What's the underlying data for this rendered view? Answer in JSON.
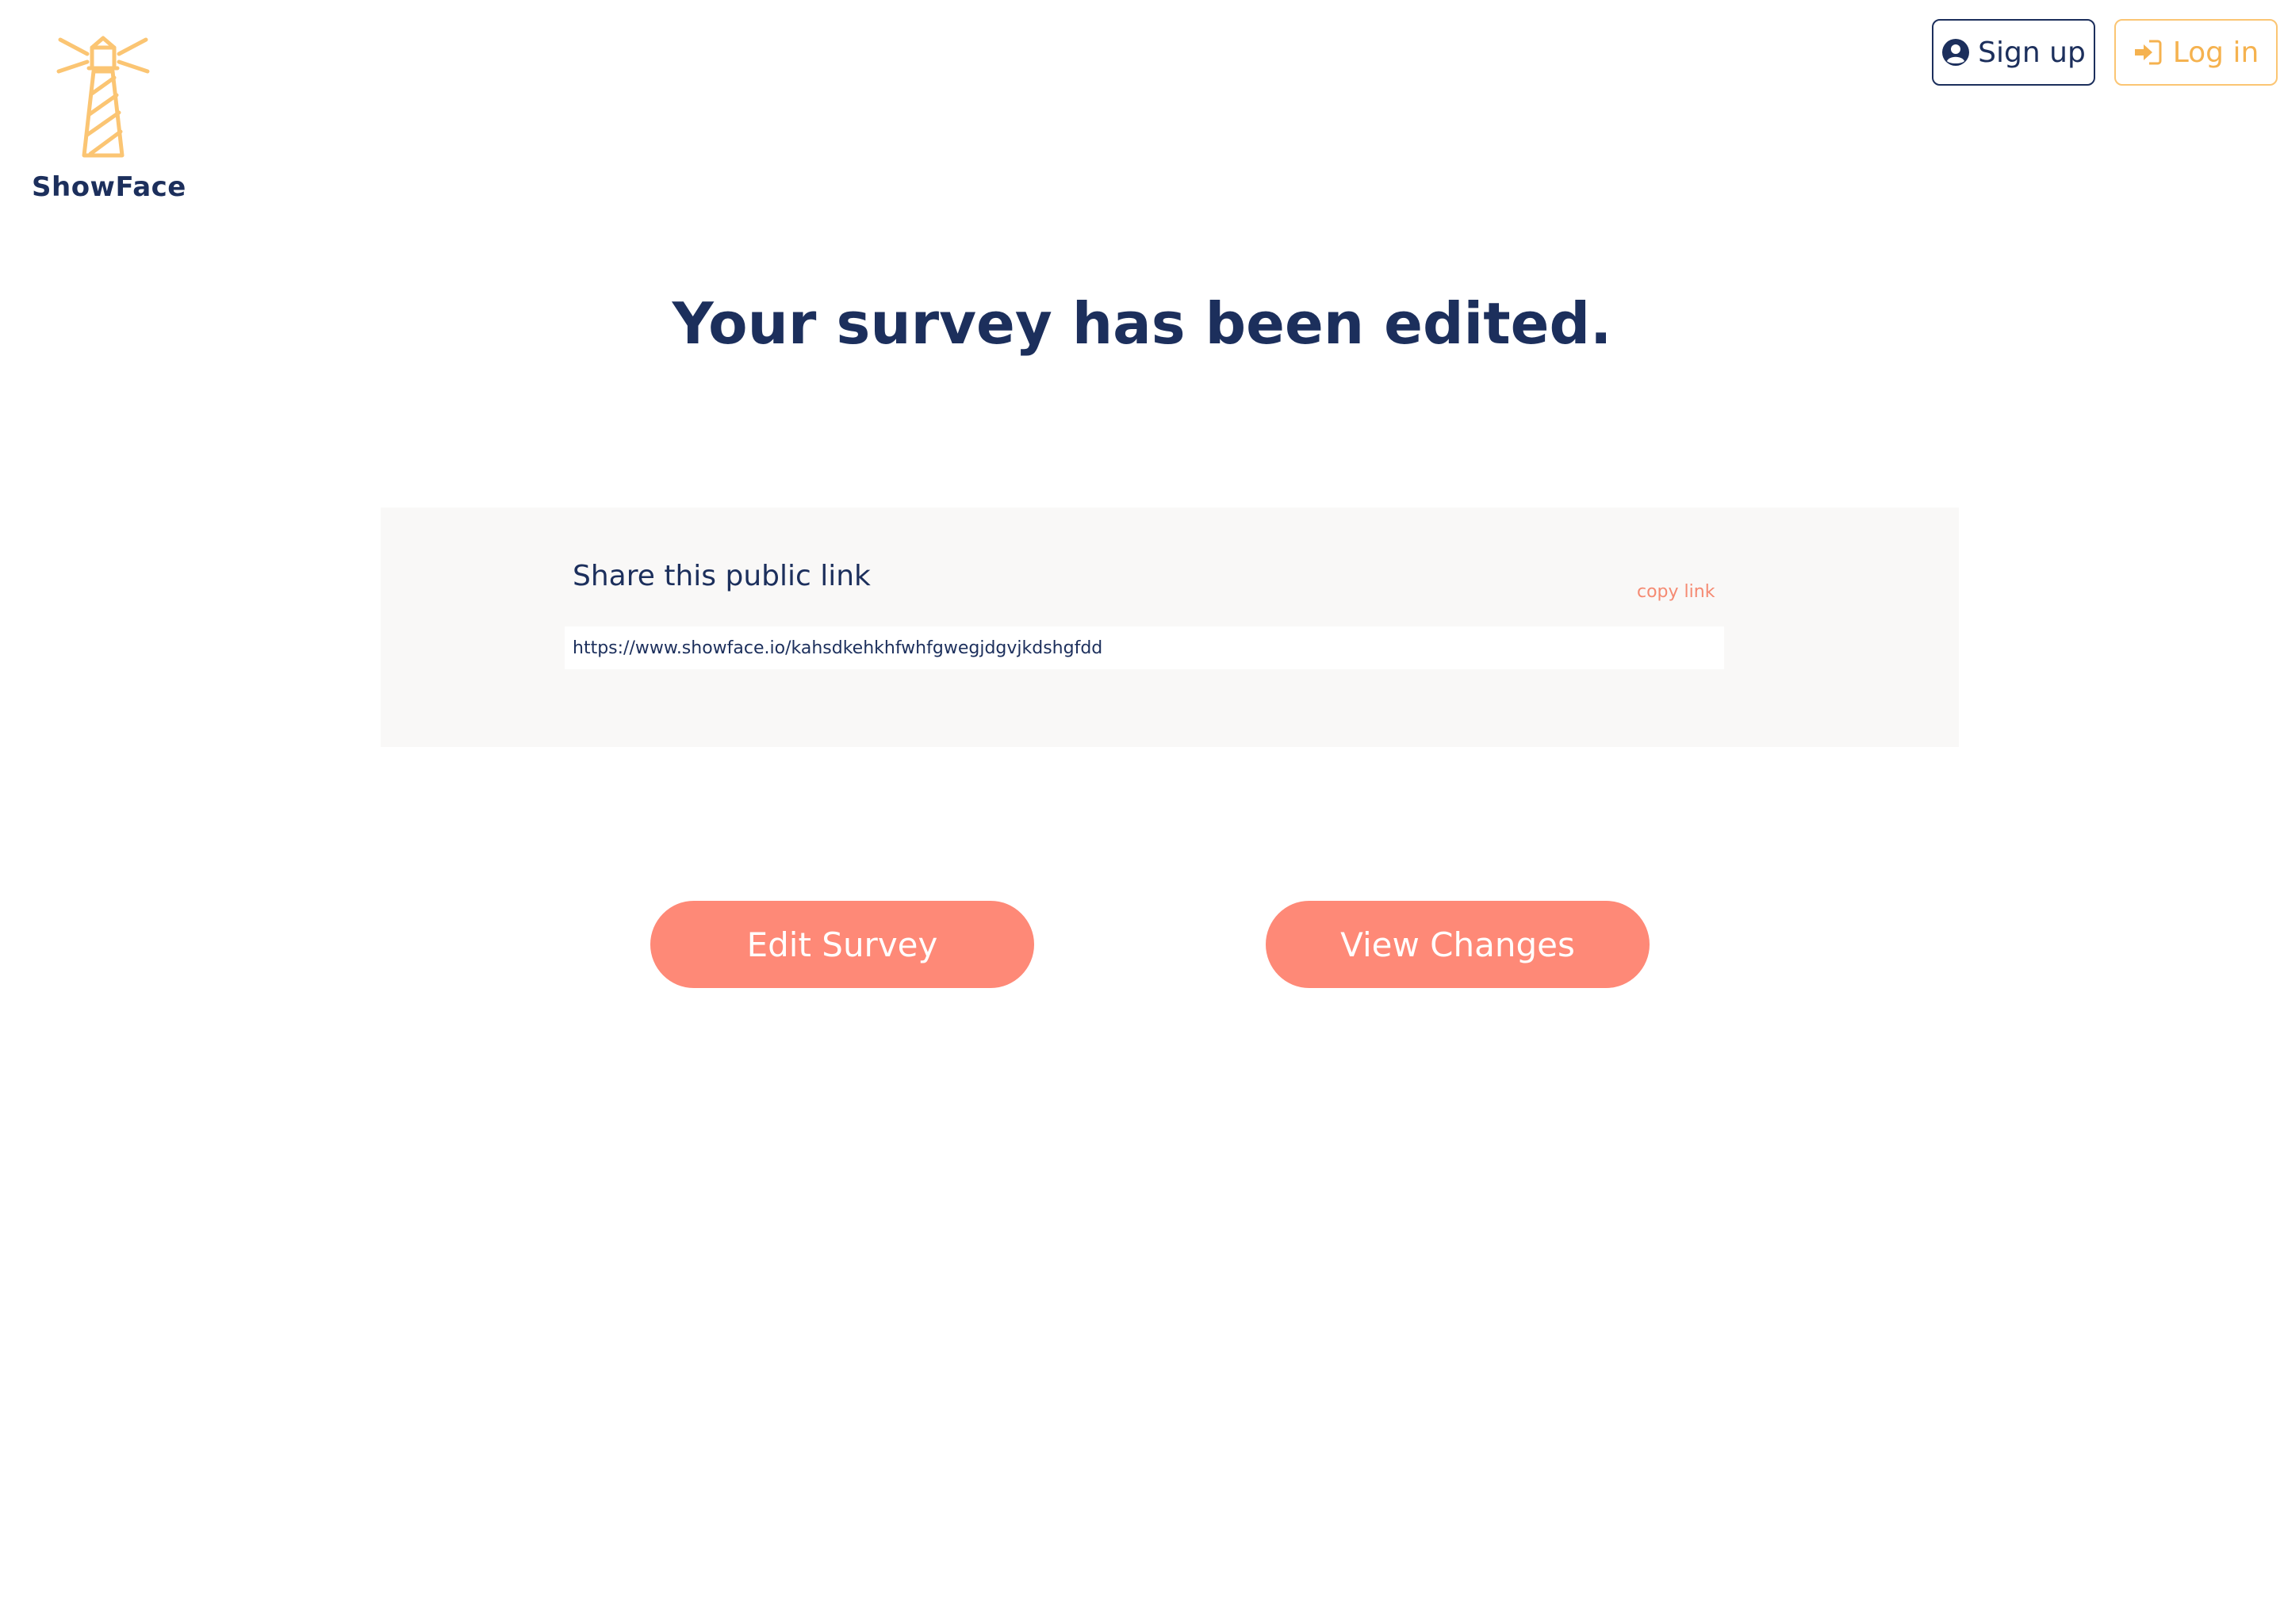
{
  "brand": {
    "name": "ShowFace",
    "accent_color": "#fbc573",
    "primary_color": "#1c2f5c"
  },
  "header": {
    "signup_label": "Sign up",
    "signup_icon": "user-circle-icon",
    "login_label": "Log in",
    "login_icon": "sign-in-icon"
  },
  "main": {
    "headline": "Your survey has been edited."
  },
  "share": {
    "title": "Share this public link",
    "copy_label": "copy link",
    "link_value": "https://www.showface.io/kahsdkehkhfwhfgwegjdgvjkdshgfdd"
  },
  "actions": {
    "edit_label": "Edit Survey",
    "view_label": "View Changes",
    "button_color": "#fe8977"
  }
}
